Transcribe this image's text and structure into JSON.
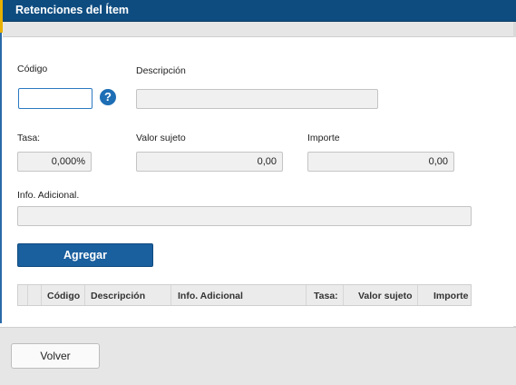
{
  "window": {
    "title": "Retenciones del Ítem"
  },
  "form": {
    "codigo": {
      "label": "Código",
      "value": ""
    },
    "help_symbol": "?",
    "descripcion": {
      "label": "Descripción",
      "value": ""
    },
    "tasa": {
      "label": "Tasa:",
      "value": "0,000%"
    },
    "valor_sujeto": {
      "label": "Valor sujeto",
      "value": "0,00"
    },
    "importe": {
      "label": "Importe",
      "value": "0,00"
    },
    "info_adicional": {
      "label": "Info. Adicional.",
      "value": ""
    }
  },
  "actions": {
    "agregar_label": "Agregar",
    "volver_label": "Volver"
  },
  "grid": {
    "columns": [
      "Código",
      "Descripción",
      "Info. Adicional",
      "Tasa:",
      "Valor sujeto",
      "Importe"
    ]
  },
  "colors": {
    "header_bg": "#0e4c80",
    "button_primary": "#1a5f9e",
    "accent_edge": "#e8b100"
  }
}
